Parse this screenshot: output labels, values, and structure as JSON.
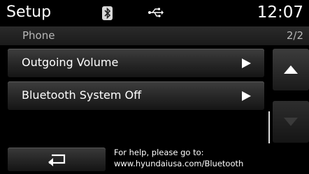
{
  "header": {
    "title": "Setup",
    "clock": "12:07",
    "icons": [
      "bluetooth-icon",
      "usb-icon"
    ]
  },
  "subheader": {
    "section": "Phone",
    "page_indicator": "2/2"
  },
  "menu": {
    "items": [
      {
        "label": "Outgoing Volume",
        "icon": "arrow-right-icon"
      },
      {
        "label": "Bluetooth System Off",
        "icon": "arrow-right-icon"
      }
    ]
  },
  "scroll": {
    "up_icon": "arrow-up-icon",
    "down_icon": "arrow-down-icon"
  },
  "footer": {
    "back_icon": "return-arrow-icon",
    "help_line1": "For help, please go to:",
    "help_line2": "www.hyundaiusa.com/Bluetooth"
  },
  "colors": {
    "background": "#000000",
    "text": "#ffffff",
    "secondary_text": "#b8b8b8",
    "disabled_icon": "#3a3a3a"
  }
}
